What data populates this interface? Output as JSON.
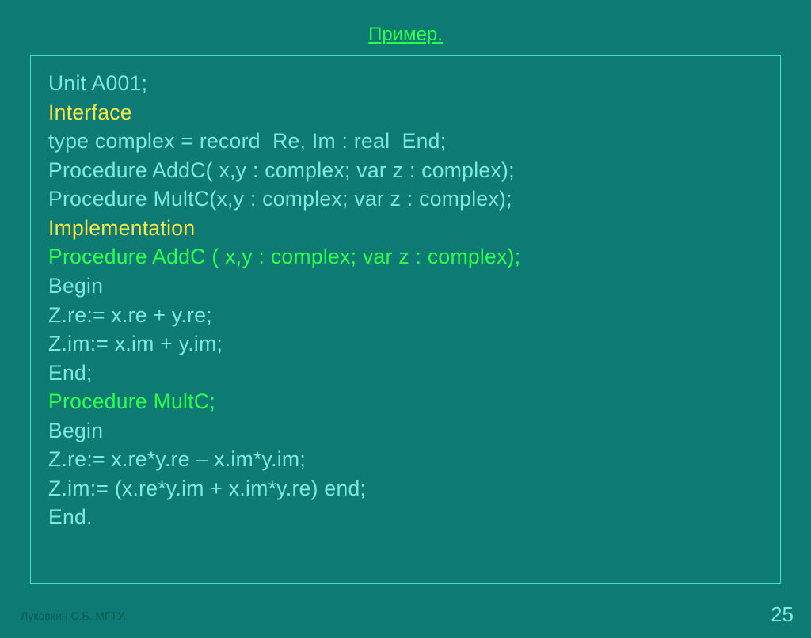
{
  "title": "Пример.",
  "code": {
    "l1": "Unit A001;",
    "l2": "Interface",
    "l3": "type complex = record  Re, Im : real  End;",
    "l4": "Procedure AddC( x,y : complex; var z : complex);",
    "l5": "Procedure MultC(x,y : complex; var z : complex);",
    "l6": "Implementation",
    "l7": "Procedure AddC ( x,y : complex; var z : complex);",
    "l8": "Begin",
    "l9": "Z.re:= x.re + y.re;",
    "l10": "Z.im:= x.im + y.im;",
    "l11": "End;",
    "l12": "Procedure MultC;",
    "l13": "Begin",
    "l14": "Z.re:= x.re*y.re – x.im*y.im;",
    "l15": "Z.im:= (x.re*y.im + x.im*y.re) end;",
    "l16": "End."
  },
  "footer": {
    "author": "Луковкин С.Б. МГТУ.",
    "page": "25"
  }
}
